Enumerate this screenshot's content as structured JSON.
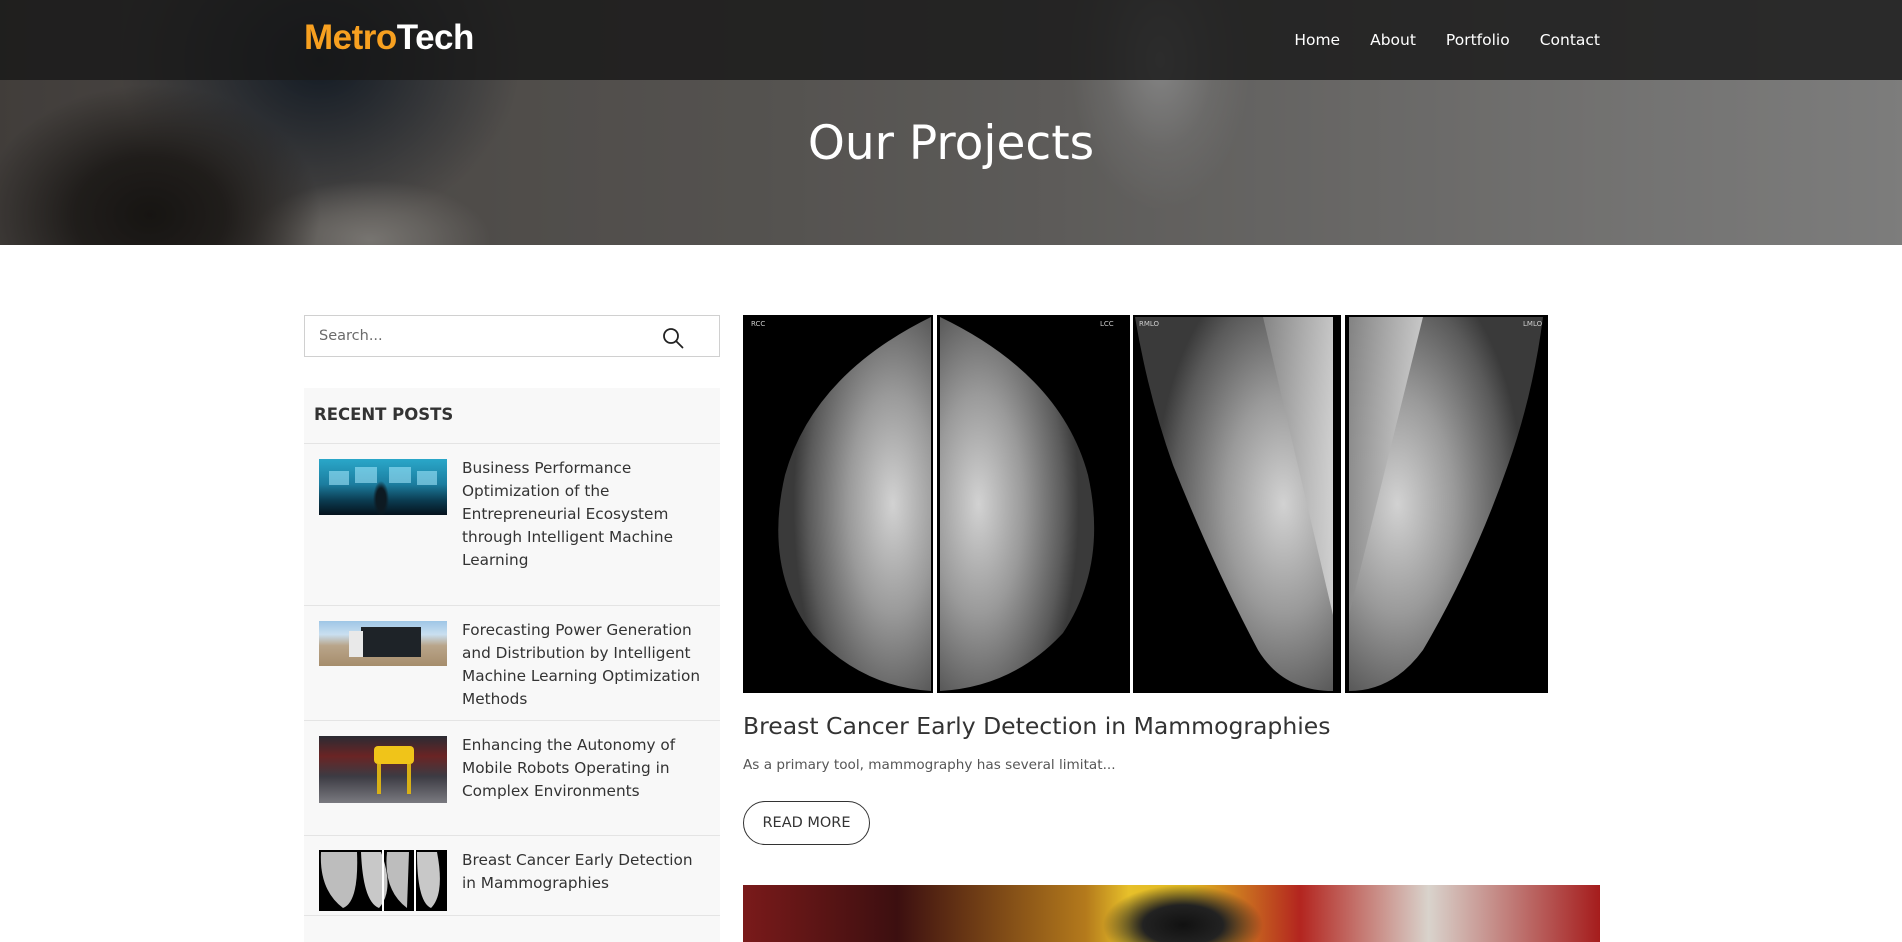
{
  "brand": {
    "part1": "Metro",
    "part2": "Tech"
  },
  "nav": [
    "Home",
    "About",
    "Portfolio",
    "Contact"
  ],
  "hero": {
    "title": "Our Projects"
  },
  "search": {
    "placeholder": "Search..."
  },
  "sidebar": {
    "recent_title": "RECENT POSTS",
    "posts": [
      {
        "title": "Business Performance Optimization of the Entrepreneurial Ecosystem through Intelligent Machine Learning"
      },
      {
        "title": "Forecasting Power Generation and Distribution by Intelligent Machine Learning Optimization Methods"
      },
      {
        "title": "Enhancing the Autonomy of Mobile Robots Operating in Complex Environments"
      },
      {
        "title": "Breast Cancer Early Detection in Mammographies"
      }
    ]
  },
  "article": {
    "title": "Breast Cancer Early Detection in Mammographies",
    "excerpt": "As a primary tool, mammography has several limitat...",
    "read_more": "READ MORE",
    "image_labels": [
      "RCC",
      "LCC",
      "RMLO",
      "LMLO"
    ]
  },
  "colors": {
    "brand_orange": "#f7a020",
    "header_bg": "#181818"
  }
}
